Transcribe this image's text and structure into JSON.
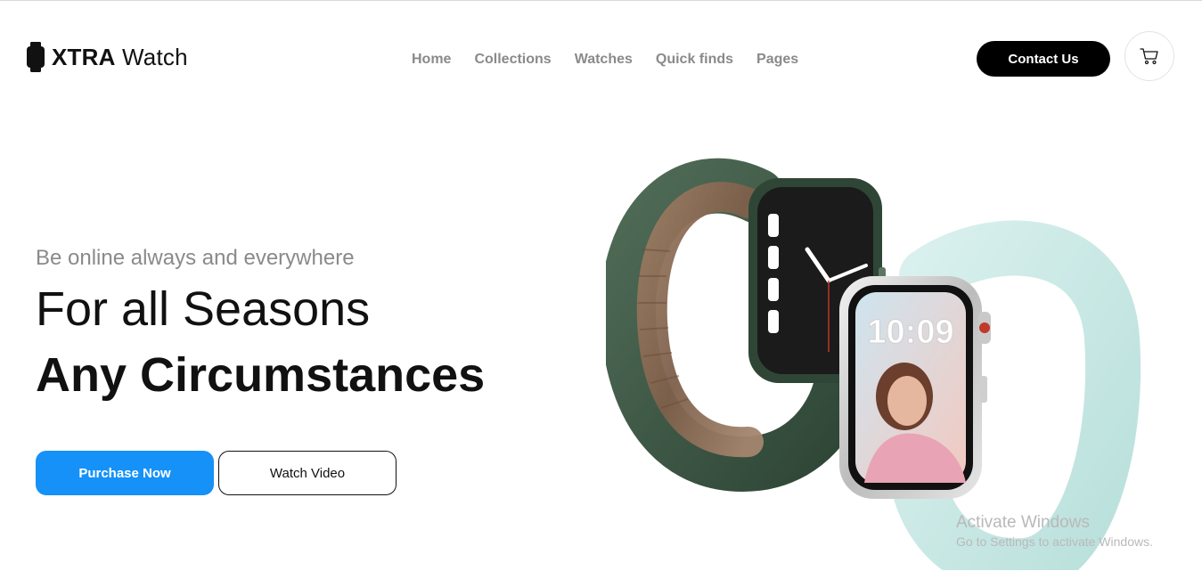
{
  "brand": {
    "name_bold": "XTRA",
    "name_light": "Watch"
  },
  "nav": {
    "items": [
      "Home",
      "Collections",
      "Watches",
      "Quick finds",
      "Pages"
    ]
  },
  "header": {
    "contact_label": "Contact Us",
    "cart_icon": "cart-icon"
  },
  "hero": {
    "subtitle": "Be online always and everywhere",
    "headline_1": "For all Seasons",
    "headline_2": "Any Circumstances",
    "primary_button": "Purchase Now",
    "secondary_button": "Watch Video",
    "watch_time": "10:09"
  },
  "watermark": {
    "title": "Activate Windows",
    "subtitle": "Go to Settings to activate Windows."
  },
  "colors": {
    "accent": "#1591f8",
    "dark": "#000000",
    "nav_text": "#8a8a8a"
  }
}
